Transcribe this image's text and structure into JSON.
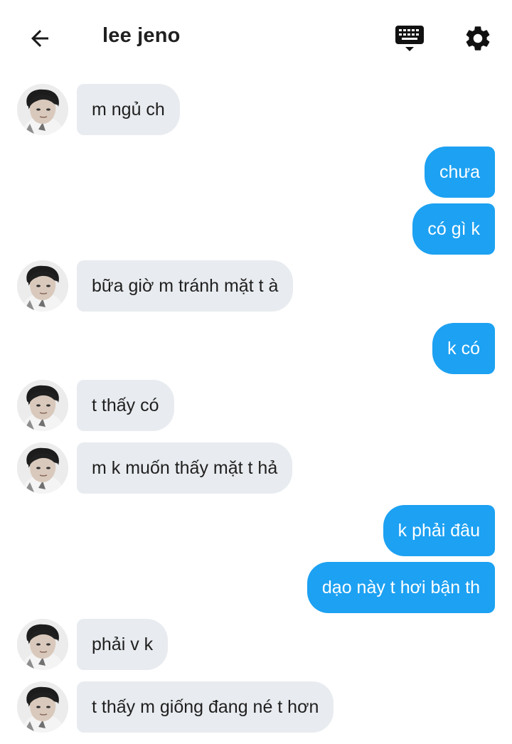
{
  "header": {
    "title": "lee jeno",
    "back_icon": "arrow-left-icon",
    "keyboard_icon": "keyboard-icon",
    "settings_icon": "gear-icon"
  },
  "colors": {
    "outgoing_bubble": "#1da1f2",
    "incoming_bubble": "#e8ebef"
  },
  "messages": [
    {
      "from": "them",
      "text": "m ngủ ch"
    },
    {
      "from": "me",
      "text": "chưa"
    },
    {
      "from": "me",
      "text": "có gì k"
    },
    {
      "from": "them",
      "text": "bữa giờ m tránh mặt t à"
    },
    {
      "from": "me",
      "text": "k có"
    },
    {
      "from": "them",
      "text": "t thấy có"
    },
    {
      "from": "them",
      "text": "m k muốn thấy mặt t hả"
    },
    {
      "from": "me",
      "text": "k phải đâu"
    },
    {
      "from": "me",
      "text": "dạo này t hơi bận th"
    },
    {
      "from": "them",
      "text": "phải v k"
    },
    {
      "from": "them",
      "text": "t thấy m giống đang né t hơn"
    }
  ]
}
